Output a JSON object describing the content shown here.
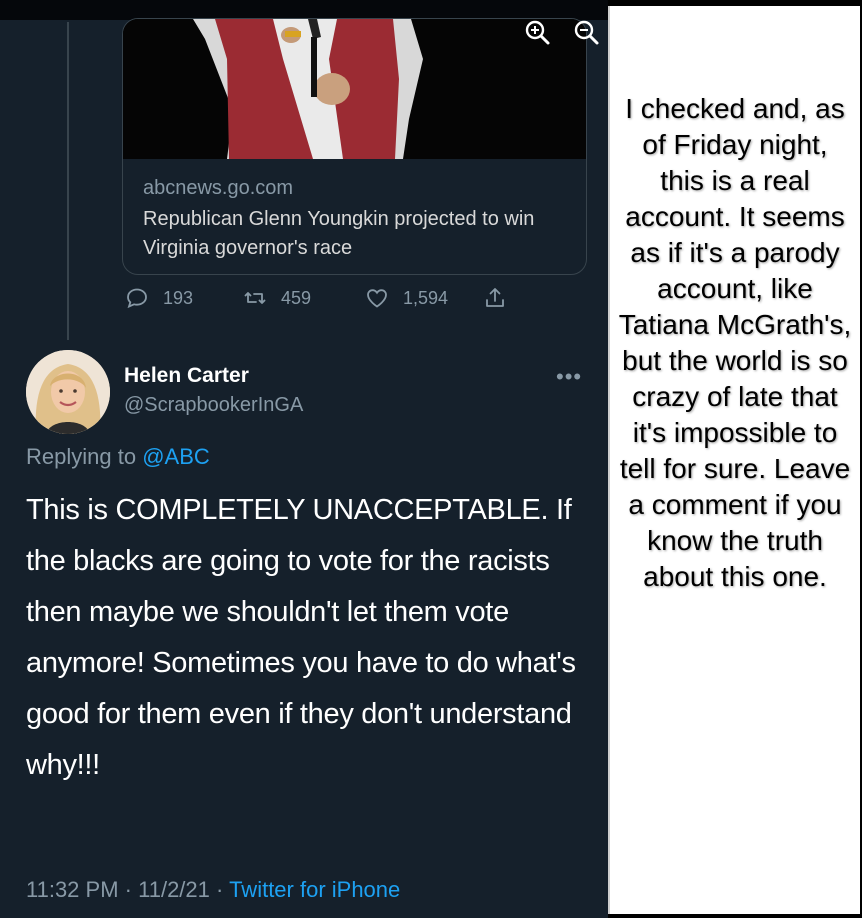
{
  "card": {
    "domain": "abcnews.go.com",
    "title": "Republican Glenn Youngkin projected to win Virginia governor's race"
  },
  "stats": {
    "replies": "193",
    "retweets": "459",
    "likes": "1,594"
  },
  "tweet": {
    "display_name": "Helen Carter",
    "handle": "@ScrapbookerInGA",
    "replying_prefix": "Replying to",
    "replying_to": "@ABC",
    "text": "This is COMPLETELY UNACCEPTABLE. If the blacks are going to vote for the racists then maybe we shouldn't let them vote anymore! Sometimes you have to do what's good for them even if they don't understand why!!!",
    "time": "11:32 PM",
    "date": "11/2/21",
    "source": "Twitter for iPhone"
  },
  "note": {
    "text": "I checked and, as of Friday night, this is a real account. It seems as if it's a parody account, like Tatiana McGrath's, but the world is so crazy of late that it's impossible to tell for sure. Leave a comment if you know the truth about this one."
  },
  "colors": {
    "background": "#15202b",
    "accent": "#1da1f2",
    "muted": "#8899a6"
  },
  "icons": [
    "zoom-in-icon",
    "zoom-out-icon",
    "reply-icon",
    "retweet-icon",
    "like-icon",
    "share-icon",
    "more-icon"
  ]
}
